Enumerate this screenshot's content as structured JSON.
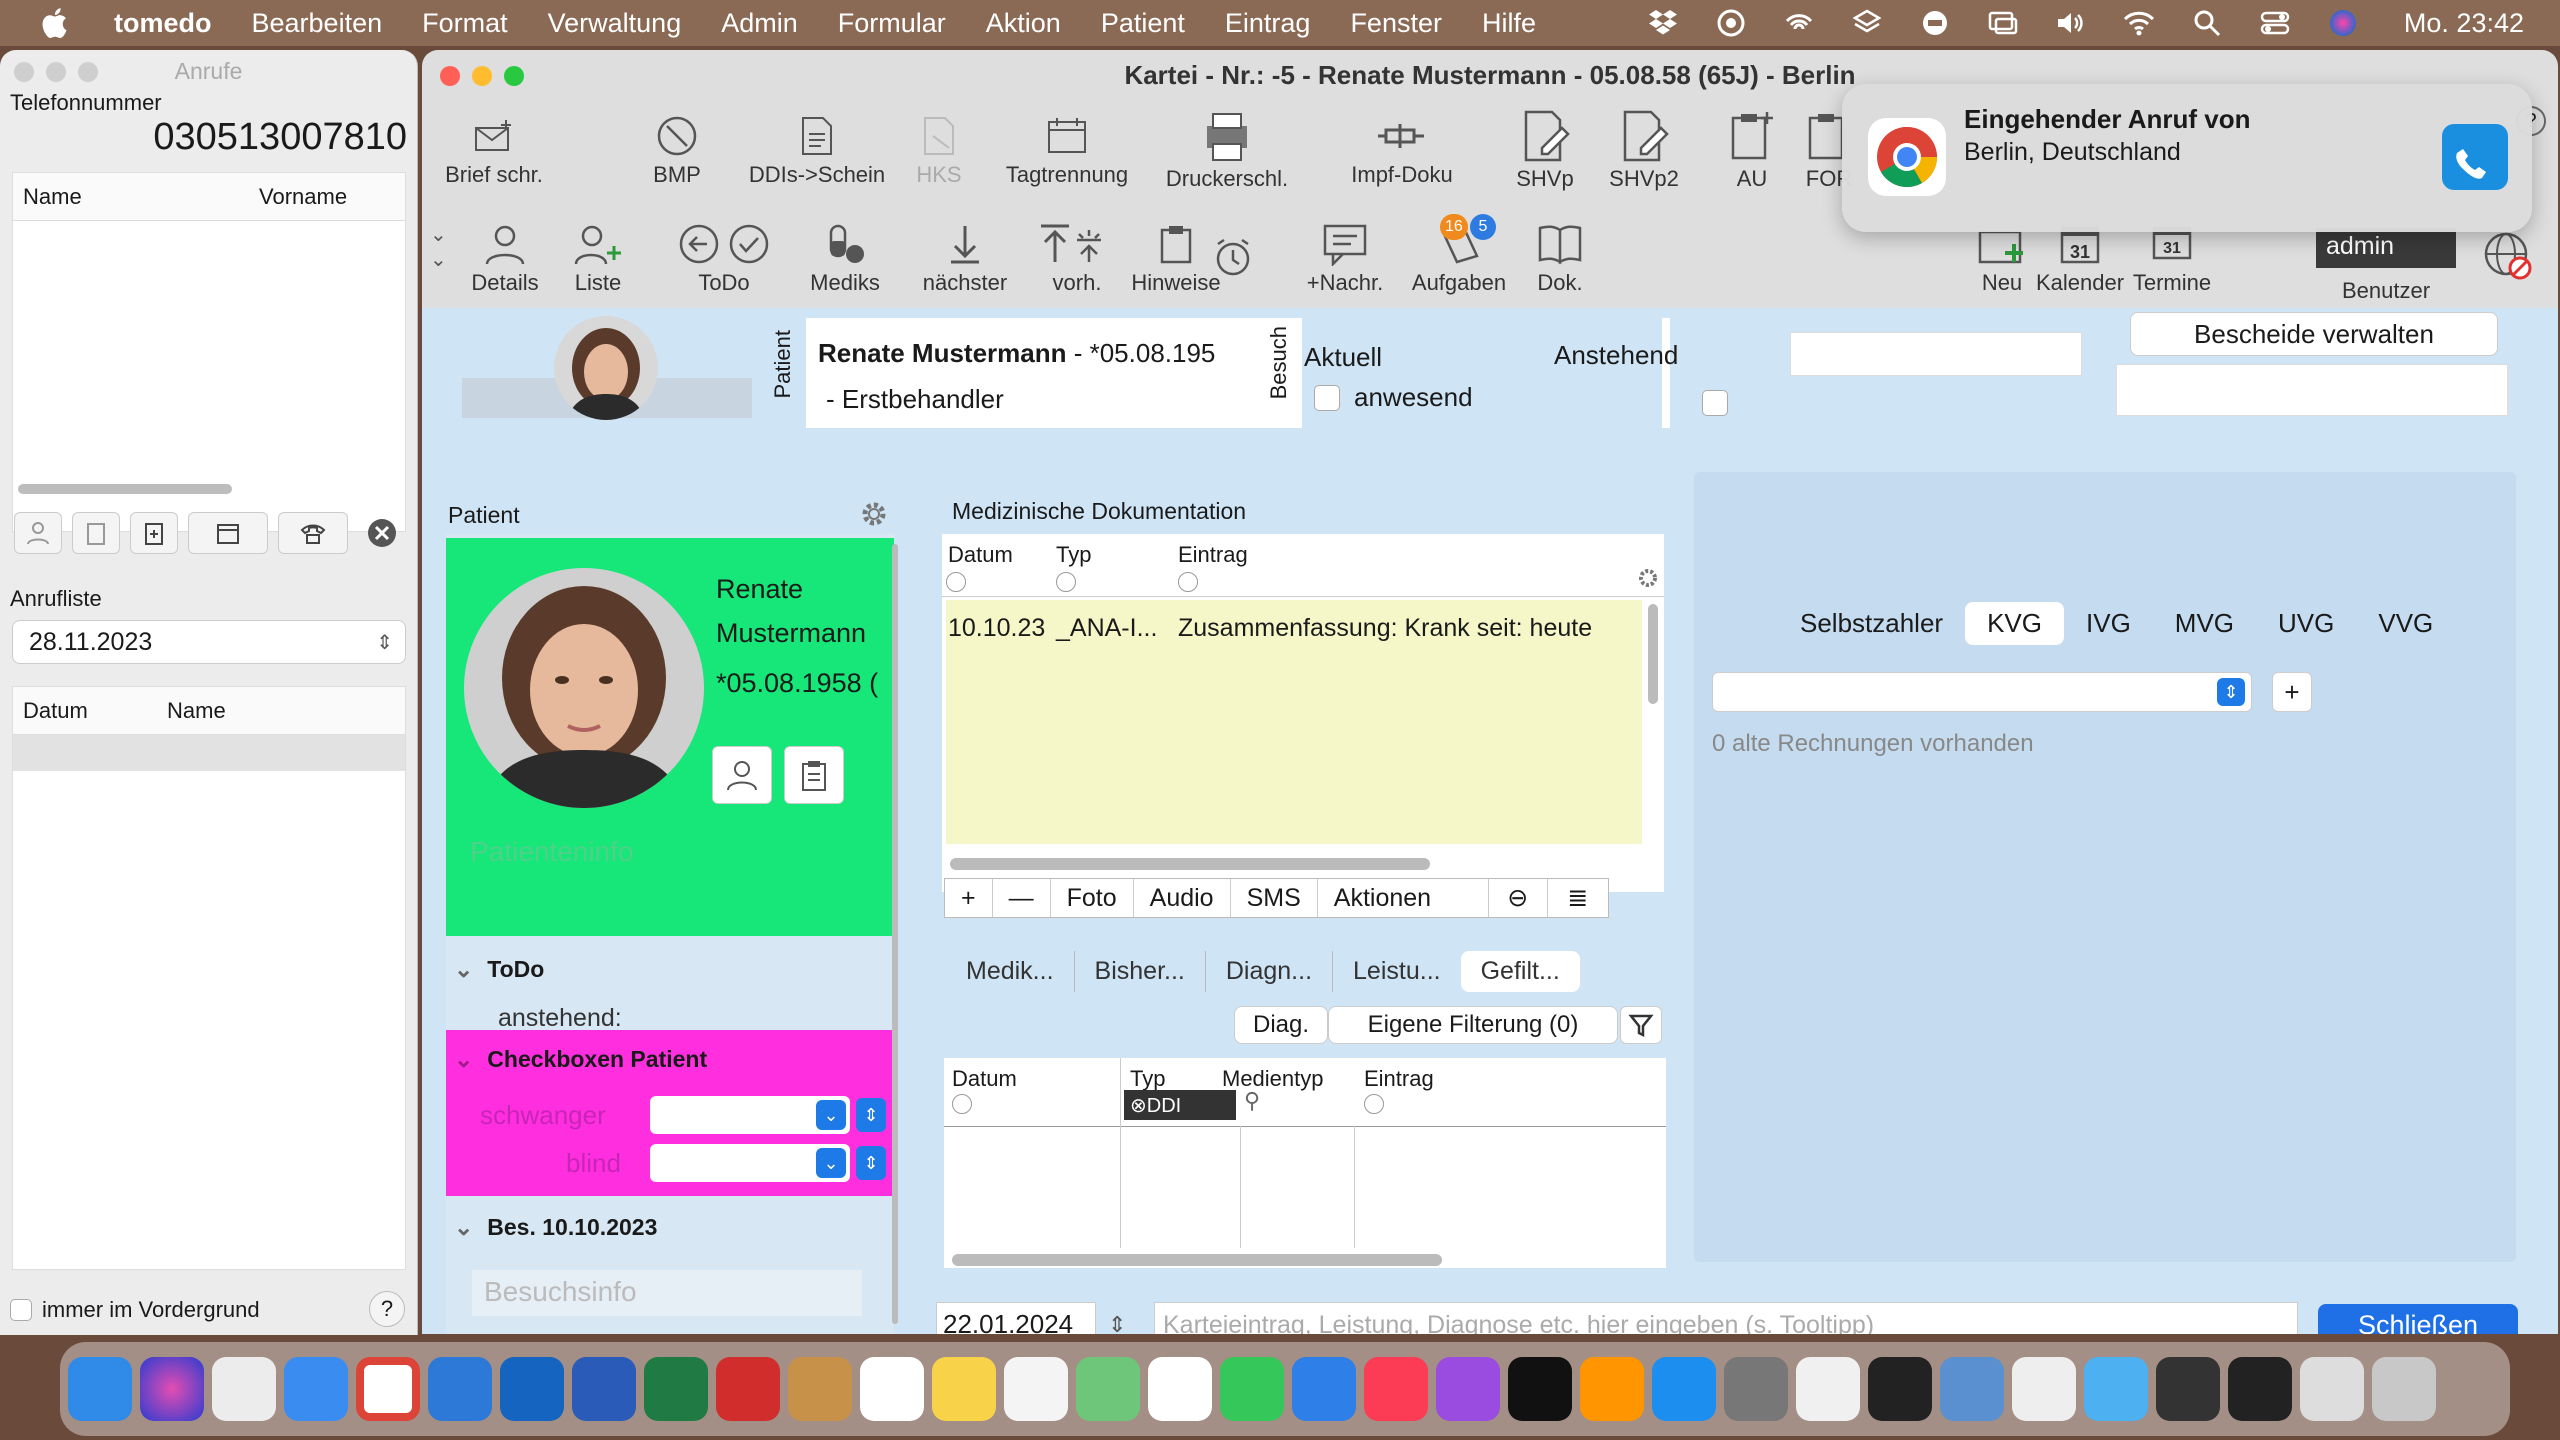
{
  "menubar": {
    "app": "tomedo",
    "items": [
      "Bearbeiten",
      "Format",
      "Verwaltung",
      "Admin",
      "Formular",
      "Aktion",
      "Patient",
      "Eintrag",
      "Fenster",
      "Hilfe"
    ],
    "clock": "Mo.  23:42"
  },
  "calls": {
    "title": "Anrufe",
    "phone_label": "Telefonnummer",
    "phone_number": "030513007810",
    "col_name": "Name",
    "col_vorname": "Vorname",
    "list_label": "Anrufliste",
    "date": "28.11.2023",
    "col_datum": "Datum",
    "col_name2": "Name",
    "always_front": "immer im Vordergrund",
    "help": "?"
  },
  "window": {
    "title": "Kartei - Nr.: -5 - Renate Mustermann - 05.08.58 (65J) - Berlin"
  },
  "toolbar1": [
    {
      "label": "Brief schr.",
      "icon": "letter-icon"
    },
    {
      "label": "BMP",
      "icon": "bmp-icon"
    },
    {
      "label": "DDIs->Schein",
      "icon": "document-icon"
    },
    {
      "label": "HKS",
      "icon": "hks-icon"
    },
    {
      "label": "Tagtrennung",
      "icon": "calendar-icon"
    },
    {
      "label": "Druckerschl.",
      "icon": "printer-icon"
    },
    {
      "label": "Impf-Doku",
      "icon": "syringe-icon"
    },
    {
      "label": "SHVp",
      "icon": "shvp-icon"
    },
    {
      "label": "SHVp2",
      "icon": "shvp2-icon"
    },
    {
      "label": "AU",
      "icon": "au-icon"
    },
    {
      "label": "FOR",
      "icon": "form-icon"
    }
  ],
  "toolbar2": [
    {
      "label": "Details",
      "icon": "person-icon"
    },
    {
      "label": "Liste",
      "icon": "person-add-icon"
    },
    {
      "label": "ToDo",
      "icon": "back-arrow-icon"
    },
    {
      "label": "Mediks",
      "icon": "pills-icon"
    },
    {
      "label": "nächster",
      "icon": "down-arrow-icon"
    },
    {
      "label": "vorh.",
      "icon": "up-arrow-icon"
    },
    {
      "label": "Hinweise",
      "icon": "clipboard-icon"
    },
    {
      "label": "+Nachr.",
      "icon": "message-icon"
    },
    {
      "label": "Aufgaben",
      "icon": "tasks-icon"
    },
    {
      "label": "Dok.",
      "icon": "book-icon"
    },
    {
      "label": "Neu",
      "icon": "new-icon"
    },
    {
      "label": "Kalender",
      "icon": "calendar31-icon"
    },
    {
      "label": "Termine",
      "icon": "termine-icon"
    },
    {
      "label": "Benutzer",
      "icon": "user-icon"
    }
  ],
  "badges": {
    "aufgaben_orange": "16",
    "aufgaben_blue": "5"
  },
  "user": "admin",
  "header": {
    "patient_vlabel": "Patient",
    "name": "Renate Mustermann",
    "dob_part": " - *05.08.195",
    "sub": "- Erstbehandler",
    "besuch_vlabel": "Besuch",
    "aktuell": "Aktuell",
    "anwesend": "anwesend",
    "anstehend": "Anstehend",
    "bescheide": "Bescheide verwalten"
  },
  "patient_panel": {
    "title": "Patient",
    "first": "Renate",
    "last": "Mustermann",
    "dob": "*05.08.1958 (",
    "info": "Patienteninfo",
    "todo": "ToDo",
    "anstehend": "anstehend:",
    "checkboxes": "Checkboxen Patient",
    "schwanger": "schwanger",
    "blind": "blind",
    "besuch": "Bes. 10.10.2023",
    "besuchsinfo": "Besuchsinfo"
  },
  "doc": {
    "title": "Medizinische Dokumentation",
    "col_datum": "Datum",
    "col_typ": "Typ",
    "col_eintrag": "Eintrag",
    "row": {
      "datum": "10.10.23",
      "typ": "_ANA-I...",
      "eintrag": "Zusammenfassung: Krank seit: heute"
    },
    "actions": [
      "+",
      "—",
      "Foto",
      "Audio",
      "SMS",
      "Aktionen"
    ],
    "tabs": [
      "Medik...",
      "Bisher...",
      "Diagn...",
      "Leistu...",
      "Gefilt..."
    ],
    "diag_btn": "Diag.",
    "filter_btn": "Eigene Filterung (0)",
    "t2_datum": "Datum",
    "t2_typ": "Typ",
    "t2_medientyp": "Medientyp",
    "t2_eintrag": "Eintrag",
    "ddi": "DDI"
  },
  "billing": {
    "tabs": [
      "Selbstzahler",
      "KVG",
      "IVG",
      "MVG",
      "UVG",
      "VVG"
    ],
    "active_tab": "KVG",
    "old_invoices": "0 alte Rechnungen vorhanden",
    "plus": "+"
  },
  "bottom": {
    "date": "22.01.2024",
    "placeholder": "Karteieintrag, Leistung, Diagnose etc. hier eingeben (s. Tooltipp)",
    "close": "Schließen"
  },
  "notification": {
    "title": "Eingehender Anruf von",
    "text": "Berlin, Deutschland"
  },
  "colors": {
    "green_card": "#17e678",
    "magenta": "#ff2fe0",
    "accent_blue": "#1f6fe6",
    "doc_yellow": "#f5f7c9"
  }
}
